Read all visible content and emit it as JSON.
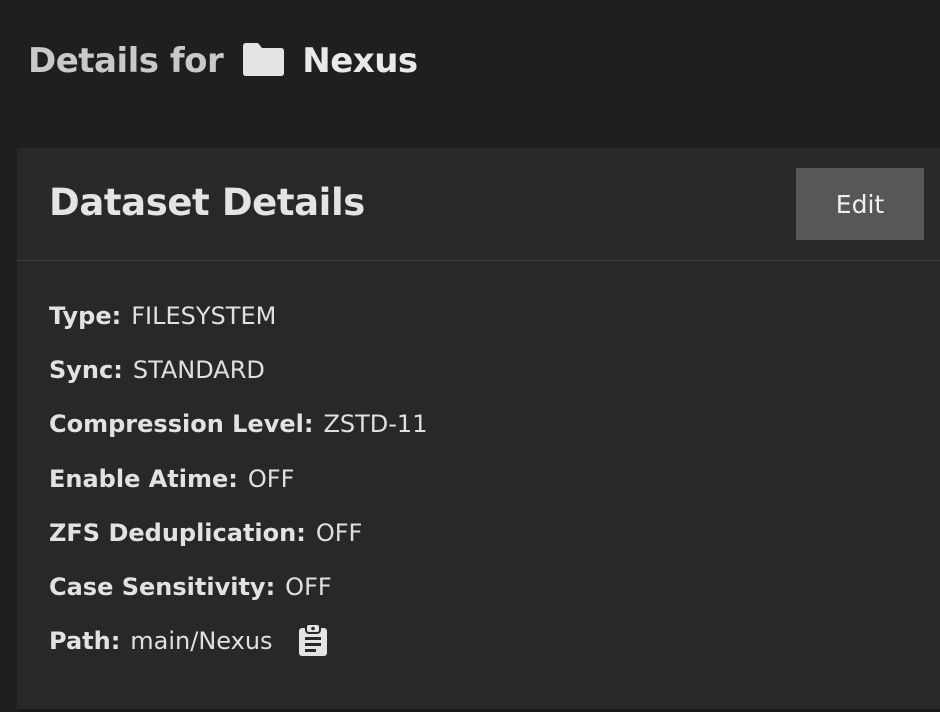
{
  "header": {
    "prefix": "Details for",
    "folder_icon": "folder-icon",
    "dataset_name": "Nexus"
  },
  "card": {
    "title": "Dataset Details",
    "edit_label": "Edit"
  },
  "details": [
    {
      "label": "Type:",
      "value": "FILESYSTEM"
    },
    {
      "label": "Sync:",
      "value": "STANDARD"
    },
    {
      "label": "Compression Level:",
      "value": "ZSTD-11"
    },
    {
      "label": "Enable Atime:",
      "value": "OFF"
    },
    {
      "label": "ZFS Deduplication:",
      "value": "OFF"
    },
    {
      "label": "Case Sensitivity:",
      "value": "OFF"
    },
    {
      "label": "Path:",
      "value": "main/Nexus",
      "action_icon": "clipboard-copy-icon"
    }
  ],
  "colors": {
    "background": "#1f1f1f",
    "card": "#282828",
    "button": "#575757",
    "text": "#e6e6e6"
  }
}
